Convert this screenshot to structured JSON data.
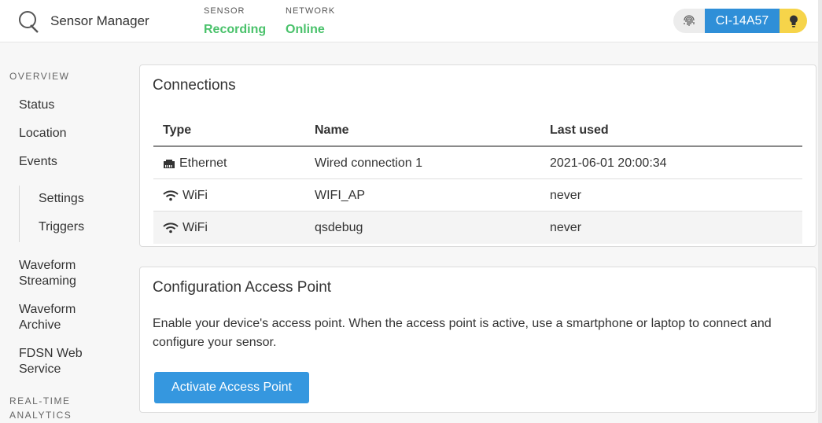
{
  "header": {
    "app_title": "Sensor Manager",
    "sensor_label": "SENSOR",
    "sensor_value": "Recording",
    "network_label": "NETWORK",
    "network_value": "Online",
    "device_id": "CI-14A57",
    "status_color": "#4ac26b",
    "accent_color": "#2f8fd8"
  },
  "sidebar": {
    "overview_label": "OVERVIEW",
    "items": [
      "Status",
      "Location",
      "Events"
    ],
    "event_subitems": [
      "Settings",
      "Triggers"
    ],
    "more_items": [
      {
        "line1": "Waveform",
        "line2": "Streaming"
      },
      {
        "line1": "Waveform",
        "line2": "Archive"
      },
      {
        "line1": "FDSN Web",
        "line2": "Service"
      }
    ],
    "analytics_label_1": "REAL-TIME",
    "analytics_label_2": "ANALYTICS"
  },
  "connections": {
    "title": "Connections",
    "columns": [
      "Type",
      "Name",
      "Last used"
    ],
    "rows": [
      {
        "icon": "ethernet-icon",
        "type": "Ethernet",
        "name": "Wired connection 1",
        "last_used": "2021-06-01 20:00:34"
      },
      {
        "icon": "wifi-icon",
        "type": "WiFi",
        "name": "WIFI_AP",
        "last_used": "never"
      },
      {
        "icon": "wifi-icon",
        "type": "WiFi",
        "name": "qsdebug",
        "last_used": "never"
      }
    ]
  },
  "access_point": {
    "title": "Configuration Access Point",
    "description": "Enable your device's access point. When the access point is active, use a smartphone or laptop to connect and configure your sensor.",
    "button_label": "Activate Access Point"
  }
}
